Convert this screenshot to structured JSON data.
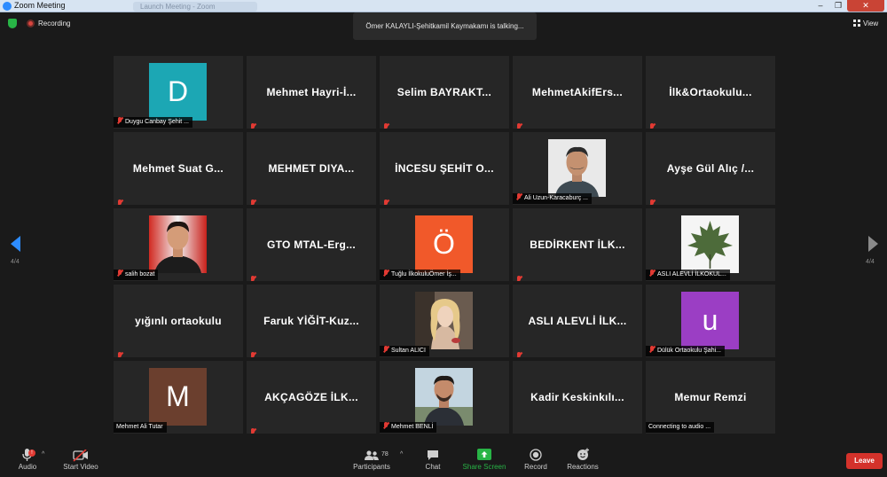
{
  "window": {
    "title": "Zoom Meeting",
    "bg_tab": "Launch Meeting - Zoom",
    "minimize": "–",
    "maximize": "❐",
    "close": "✕"
  },
  "topbar": {
    "recording_label": "Recording",
    "talking": "Ömer KALAYLI-Şehitkamil Kaymakamı is talking...",
    "view_label": "View"
  },
  "nav": {
    "left_page": "4/4",
    "right_page": "4/4"
  },
  "colors": {
    "accent": "#2d8cff",
    "muted": "#e23a33",
    "leave": "#d4322b",
    "share": "#28b446"
  },
  "tiles": [
    {
      "type": "avatar",
      "letter": "D",
      "color": "#1ca7b4",
      "label": "Duygu Canbay Şehit ..."
    },
    {
      "type": "name",
      "name": "Mehmet Hayri-İ..."
    },
    {
      "type": "name",
      "name": "Selim BAYRAKT..."
    },
    {
      "type": "name",
      "name": "MehmetAkifErs..."
    },
    {
      "type": "name",
      "name": "İlk&Ortaokulu..."
    },
    {
      "type": "name",
      "name": "Mehmet Suat G..."
    },
    {
      "type": "name",
      "name": "MEHMET DIYA..."
    },
    {
      "type": "name",
      "name": "İNCESU ŞEHİT O..."
    },
    {
      "type": "photo",
      "photo": "man-grey-bg",
      "label": "Ali Uzun-Karacaburç ..."
    },
    {
      "type": "name",
      "name": "Ayşe Gül Alıç /..."
    },
    {
      "type": "photo",
      "photo": "man-red-bg",
      "label": "salih bozat"
    },
    {
      "type": "name",
      "name": "GTO MTAL-Erg..."
    },
    {
      "type": "avatar",
      "letter": "Ö",
      "color": "#f1592a",
      "label": "Tuğlu İlkokuluÖmer İş..."
    },
    {
      "type": "name",
      "name": "BEDİRKENT İLK..."
    },
    {
      "type": "photo",
      "photo": "leaf",
      "label": "ASLI ALEVLİ İLKOKUL..."
    },
    {
      "type": "name",
      "name": "yığınlı ortaokulu"
    },
    {
      "type": "name",
      "name": "Faruk YİĞİT-Kuz..."
    },
    {
      "type": "photo",
      "photo": "woman",
      "label": "Sultan ALICI"
    },
    {
      "type": "name",
      "name": "ASLI ALEVLİ İLK..."
    },
    {
      "type": "avatar",
      "letter": "u",
      "color": "#9b3ec4",
      "label": "Dülük Ortaokulu Şahi..."
    },
    {
      "type": "avatar",
      "letter": "M",
      "color": "#6b3f2e",
      "label": "Mehmet Ali Tutar",
      "nomute": true
    },
    {
      "type": "name",
      "name": "AKÇAGÖZE İLK..."
    },
    {
      "type": "photo",
      "photo": "man-outdoor",
      "label": "Mehmet BENLİ"
    },
    {
      "type": "name",
      "name": "Kadir Keskinkılı...",
      "nomute": true
    },
    {
      "type": "name",
      "name": "Memur Remzi",
      "label": "Connecting to audio ...",
      "nomute": true
    }
  ],
  "toolbar": {
    "audio": "Audio",
    "audio_badge": "!",
    "video": "Start Video",
    "participants": "Participants",
    "participants_count": "78",
    "chat": "Chat",
    "share": "Share Screen",
    "record": "Record",
    "reactions": "Reactions",
    "leave": "Leave"
  }
}
